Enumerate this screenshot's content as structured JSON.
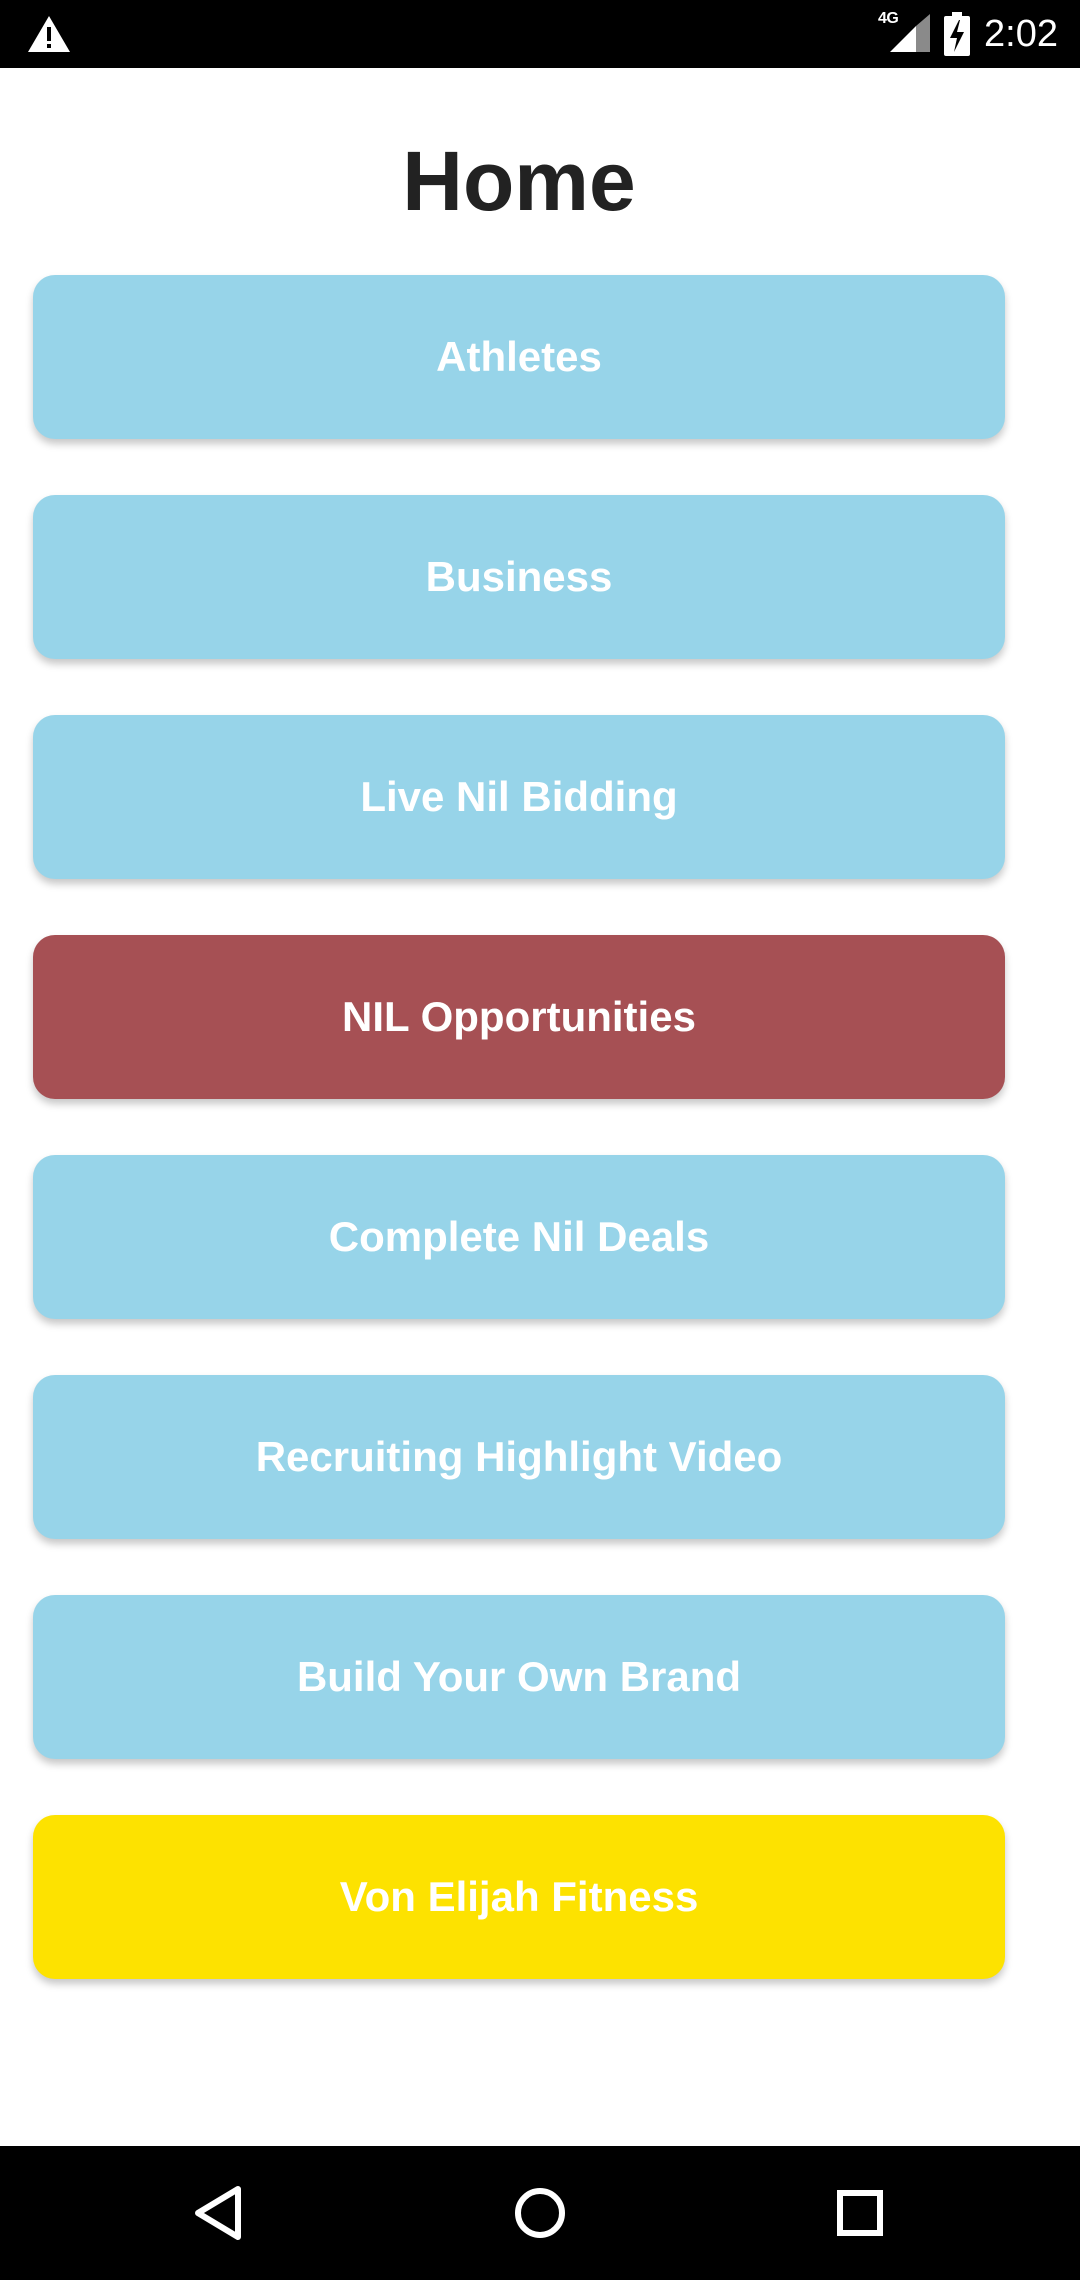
{
  "status_bar": {
    "network_label": "4G",
    "time": "2:02",
    "icons": [
      "warning-icon",
      "signal-icon",
      "battery-charging-icon"
    ]
  },
  "header": {
    "title": "Home"
  },
  "menu": {
    "buttons": [
      {
        "label": "Athletes",
        "color": "#97d4e9"
      },
      {
        "label": "Business",
        "color": "#97d4e9"
      },
      {
        "label": "Live Nil Bidding",
        "color": "#97d4e9"
      },
      {
        "label": "NIL Opportunities",
        "color": "#a65054"
      },
      {
        "label": "Complete Nil Deals",
        "color": "#97d4e9"
      },
      {
        "label": "Recruiting Highlight Video",
        "color": "#97d4e9"
      },
      {
        "label": "Build Your Own Brand",
        "color": "#97d4e9"
      },
      {
        "label": "Von Elijah Fitness",
        "color": "#fde200"
      }
    ]
  },
  "nav_bar": {
    "icons": [
      "back-icon",
      "home-icon",
      "recents-icon"
    ]
  }
}
